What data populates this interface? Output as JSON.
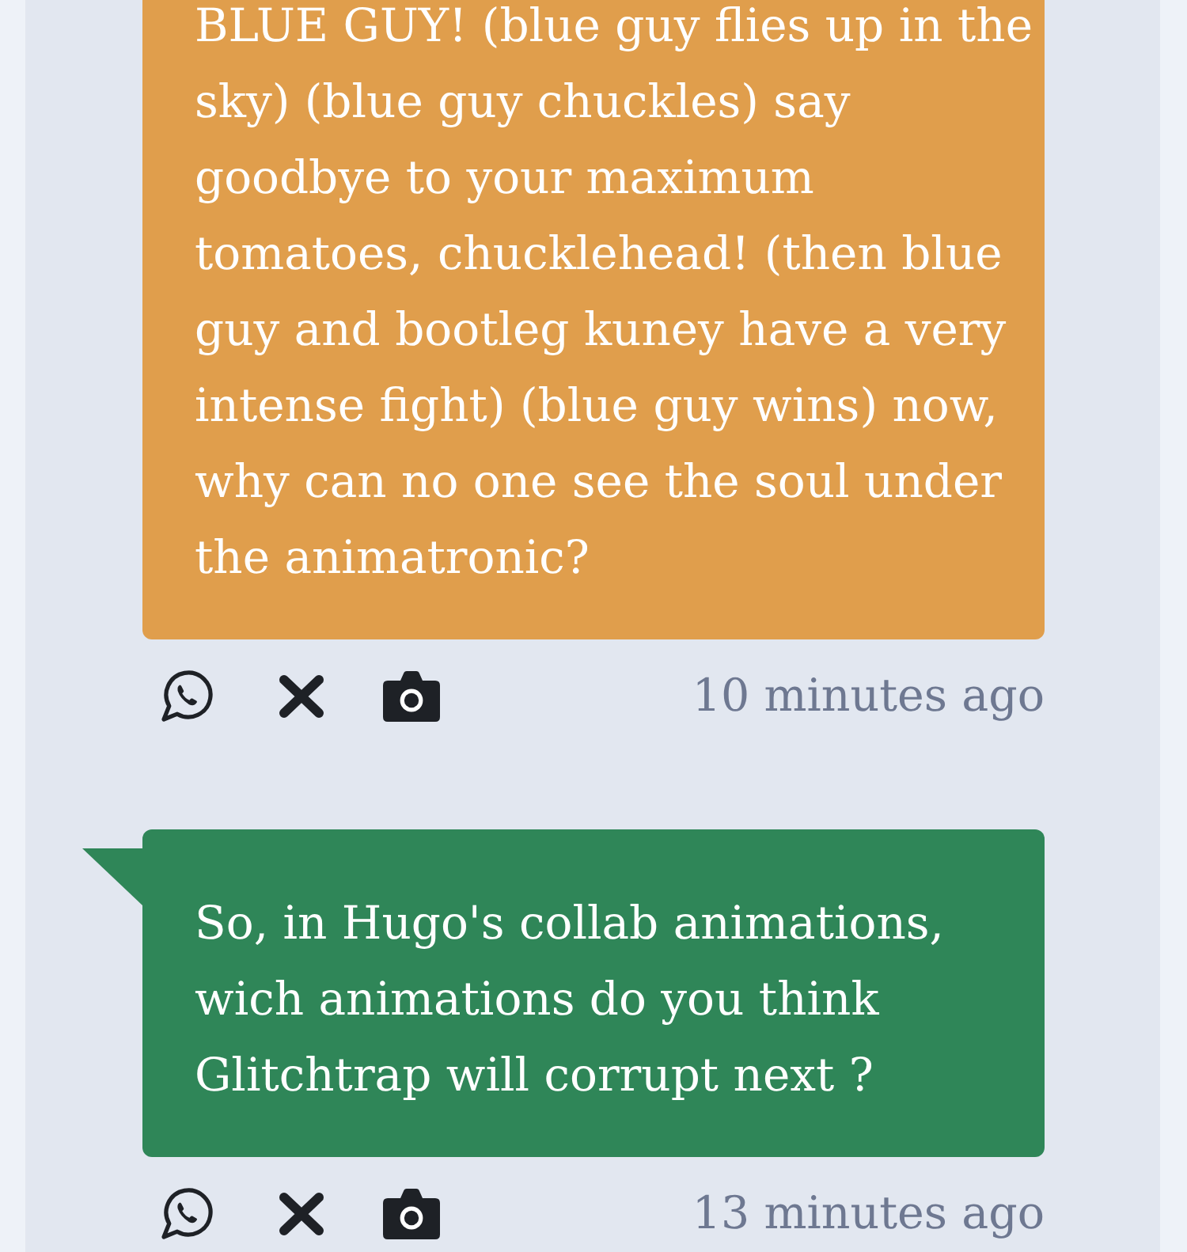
{
  "messages": [
    {
      "color": "#e09e4c",
      "tail": false,
      "text": "BLUE GUY! (blue guy flies up in the sky) (blue guy chuckles) say goodbye to your maximum tomatoes, chucklehead! (then blue guy and bootleg kuney have a very intense fight) (blue guy wins) now, why can no one see the soul under the animatronic?",
      "time": "10 minutes ago"
    },
    {
      "color": "#2f8658",
      "tail": true,
      "text": "So, in Hugo's collab animations, wich animations do you think Glitchtrap will corrupt next ?",
      "time": "13 minutes ago"
    }
  ]
}
